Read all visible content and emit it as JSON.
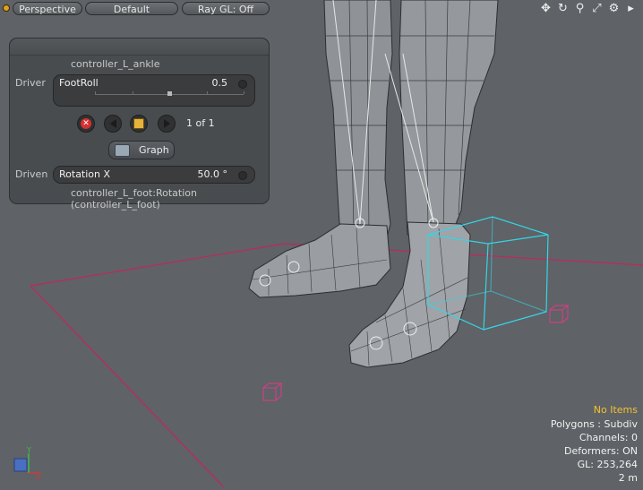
{
  "toolbar": {
    "view_label": "Perspective",
    "shading_label": "Default",
    "raygl_label": "Ray GL: Off"
  },
  "panel": {
    "title": "controller_L_ankle",
    "driver_label": "Driver",
    "driver_channel": "FootRoll",
    "driver_value": "0.5",
    "slider_fraction": 0.5,
    "key_counter": "1 of 1",
    "graph_label": "Graph",
    "driven_label": "Driven",
    "driven_channel": "Rotation X",
    "driven_value": "50.0 °",
    "driven_path": "controller_L_foot:Rotation (controller_L_foot)"
  },
  "info": {
    "items": "No Items",
    "polygons": "Polygons : Subdiv",
    "channels": "Channels: 0",
    "deformers": "Deformers: ON",
    "gl": "GL: 253,264",
    "scale": "2 m"
  },
  "axes": {
    "y": "Y",
    "x": "X"
  },
  "colors": {
    "accent": "#f2c230",
    "selection_cyan": "#33d6e6",
    "grid_magenta": "#c2275a",
    "locator_pink": "#e03a8a"
  }
}
